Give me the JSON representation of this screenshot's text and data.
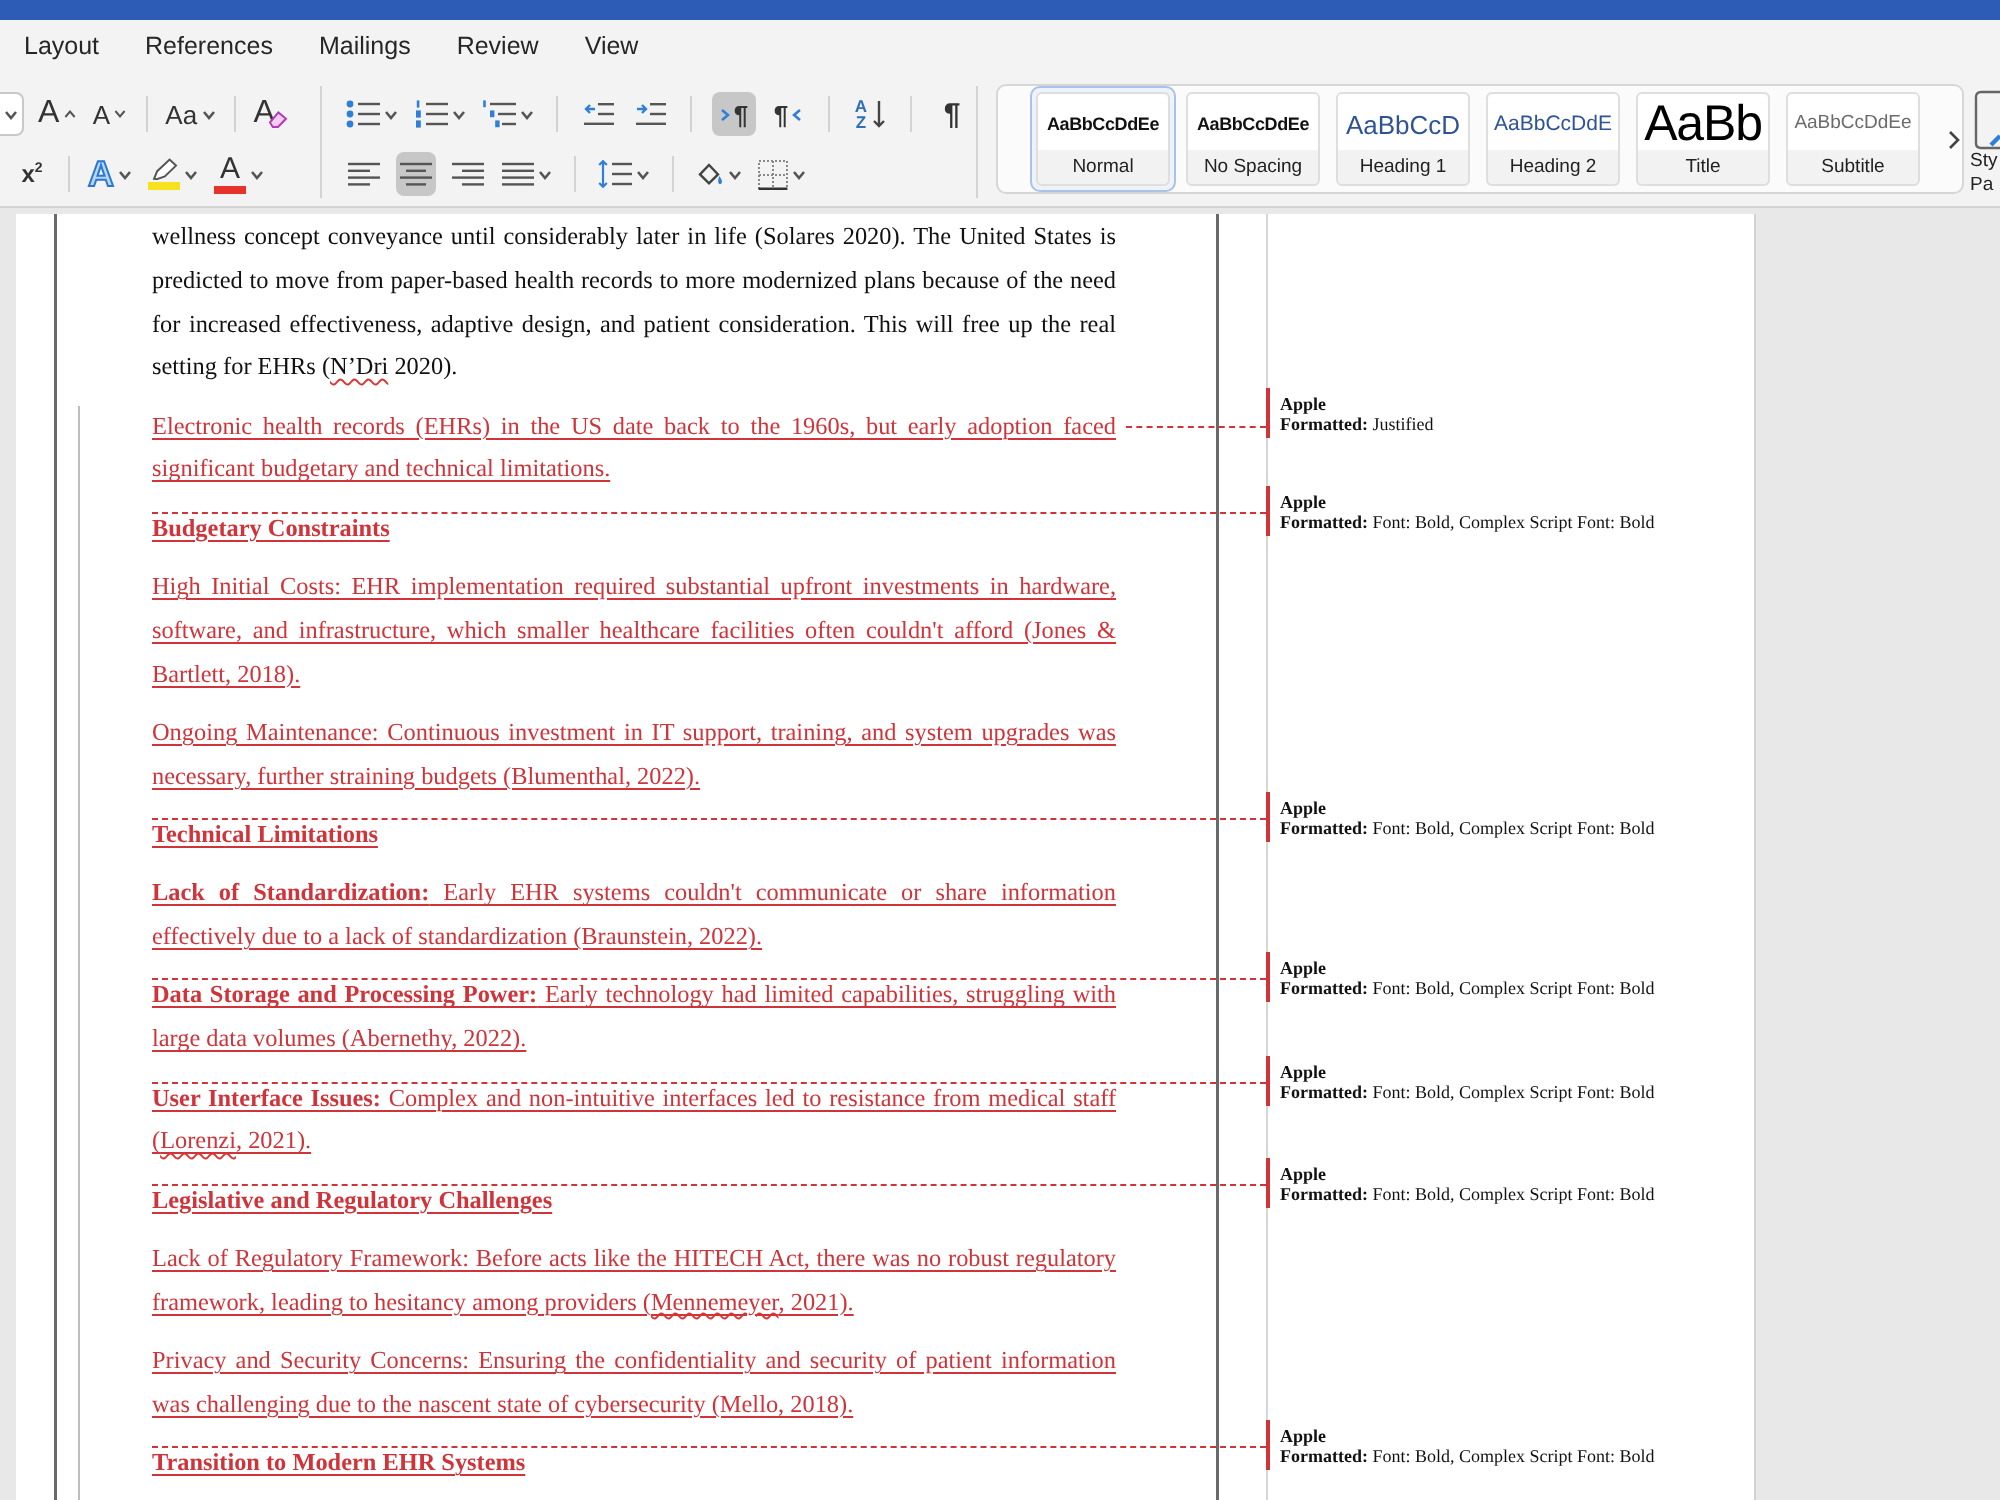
{
  "ribbon": {
    "tabs": [
      {
        "label": "Layout"
      },
      {
        "label": "References"
      },
      {
        "label": "Mailings"
      },
      {
        "label": "Review"
      },
      {
        "label": "View"
      }
    ],
    "font_group": {
      "rows": [
        [
          [
            {
              "kind": "font_size",
              "dropdown": true
            },
            {
              "kind": "grow_font",
              "label": "A",
              "dropdown": false
            },
            {
              "kind": "shrink_font",
              "label": "A",
              "dropdown": false
            }
          ],
          [
            {
              "kind": "change_case",
              "label": "Aa",
              "dropdown": true
            }
          ],
          [
            {
              "kind": "clear_formatting",
              "label": "A",
              "dropdown": false
            }
          ]
        ],
        [
          [
            {
              "kind": "superscript",
              "label": "x$^{2}$",
              "dropdown": false
            }
          ],
          [
            {
              "kind": "text_effects",
              "label": "A",
              "dropdown": true
            },
            {
              "kind": "highlight",
              "color": "#f5e21c",
              "dropdown": true
            },
            {
              "kind": "font_color",
              "label": "A",
              "color": "#e5322d",
              "dropdown": true
            }
          ]
        ]
      ]
    },
    "paragraph_group": {
      "rows": [
        [
          [
            {
              "kind": "bullets",
              "dropdown": true
            },
            {
              "kind": "numbering",
              "dropdown": true
            },
            {
              "kind": "multilevel",
              "dropdown": true
            }
          ],
          [
            {
              "kind": "decrease_indent",
              "dropdown": false
            },
            {
              "kind": "increase_indent",
              "dropdown": false
            }
          ],
          [
            {
              "kind": "ltr",
              "label": "¶",
              "selected": true,
              "dropdown": false
            },
            {
              "kind": "rtl",
              "label": "¶",
              "selected": false,
              "dropdown": false
            }
          ],
          [
            {
              "kind": "sort",
              "label": "A Z",
              "dropdown": false
            }
          ],
          [
            {
              "kind": "show_marks",
              "label": "¶",
              "dropdown": false
            }
          ]
        ],
        [
          [
            {
              "kind": "align_left",
              "selected": false,
              "dropdown": false
            },
            {
              "kind": "align_center",
              "selected": true,
              "dropdown": false
            },
            {
              "kind": "align_right",
              "selected": false,
              "dropdown": false
            },
            {
              "kind": "justify",
              "selected": false,
              "dropdown": true
            }
          ],
          [
            {
              "kind": "line_spacing",
              "dropdown": true
            }
          ],
          [
            {
              "kind": "shading",
              "dropdown": true
            },
            {
              "kind": "borders",
              "dropdown": true
            }
          ]
        ]
      ]
    },
    "styles": {
      "items": [
        {
          "kind": "normal",
          "preview": "AaBbCcDdEe",
          "name": "Normal",
          "selected": true
        },
        {
          "kind": "no_spacing",
          "preview": "AaBbCcDdEe",
          "name": "No Spacing",
          "selected": false
        },
        {
          "kind": "heading_1",
          "preview": "AaBbCcD",
          "name": "Heading 1",
          "selected": false
        },
        {
          "kind": "heading_2",
          "preview": "AaBbCcDdE",
          "name": "Heading 2",
          "selected": false
        },
        {
          "kind": "title",
          "preview": "AaBb",
          "name": "Title",
          "selected": false
        },
        {
          "kind": "subtitle",
          "preview": "AaBbCcDdEe",
          "name": "Subtitle",
          "selected": false
        }
      ],
      "pane_label": "Sty Pa"
    }
  },
  "document": {
    "paragraphs": [
      {
        "kind": "body",
        "inserted": false,
        "runs": [
          {
            "text": "wellness concept conveyance until considerably later in life (Solares 2020). The United States is predicted to move from paper-based health records to more modernized plans because of the need for increased effectiveness, adaptive design, and patient consideration. This will free up the real setting for EHRs (",
            "misspelled": false
          },
          {
            "text": "N’Dri",
            "misspelled": true
          },
          {
            "text": " 2020).",
            "misspelled": false
          }
        ]
      },
      {
        "kind": "body",
        "inserted": true,
        "text": "Electronic health records (EHRs) in the US date back to the 1960s, but early adoption faced significant budgetary and technical limitations.",
        "balloon": {
          "kind": "paragraph",
          "author": "Apple",
          "text": "**Formatted:** Justified"
        }
      },
      {
        "kind": "heading",
        "inserted": true,
        "text": "Budgetary Constraints",
        "balloon": {
          "kind": "character",
          "author": "Apple",
          "text": "**Formatted:** Font: Bold, Complex Script Font: Bold"
        }
      },
      {
        "kind": "body",
        "inserted": true,
        "text": "High Initial Costs: EHR implementation required substantial upfront investments in hardware, software, and infrastructure, which smaller healthcare facilities often couldn't afford (Jones & Bartlett, 2018)."
      },
      {
        "kind": "body",
        "inserted": true,
        "text": "Ongoing Maintenance: Continuous investment in IT support, training, and system upgrades was necessary, further straining budgets (Blumenthal, 2022)."
      },
      {
        "kind": "heading",
        "inserted": true,
        "text": "Technical Limitations",
        "balloon": {
          "kind": "character",
          "author": "Apple",
          "text": "**Formatted:** Font: Bold, Complex Script Font: Bold"
        }
      },
      {
        "kind": "body",
        "inserted": true,
        "text": "**Lack of Standardization:** Early EHR systems couldn't communicate or share information effectively due to a lack of standardization (Braunstein, 2022)."
      },
      {
        "kind": "body",
        "inserted": true,
        "text": "**Data Storage and Processing Power:** Early technology had limited capabilities, struggling with large data volumes (Abernethy, 2022).",
        "balloon": {
          "kind": "character",
          "author": "Apple",
          "text": "**Formatted:** Font: Bold, Complex Script Font: Bold"
        }
      },
      {
        "kind": "body",
        "inserted": true,
        "runs": [
          {
            "text": "**User Interface Issues:** Complex and non-intuitive interfaces led to resistance from medical staff (",
            "misspelled": false
          },
          {
            "text": "Lorenzi",
            "misspelled": true
          },
          {
            "text": ", 2021).",
            "misspelled": false
          }
        ],
        "balloon": {
          "kind": "character",
          "author": "Apple",
          "text": "**Formatted:** Font: Bold, Complex Script Font: Bold"
        }
      },
      {
        "kind": "heading",
        "inserted": true,
        "text": "Legislative and Regulatory Challenges",
        "balloon": {
          "kind": "character",
          "author": "Apple",
          "text": "**Formatted:** Font: Bold, Complex Script Font: Bold"
        }
      },
      {
        "kind": "body",
        "inserted": true,
        "runs": [
          {
            "text": "Lack of Regulatory Framework: Before acts like the HITECH Act, there was no robust regulatory framework, leading to hesitancy among providers (",
            "misspelled": false
          },
          {
            "text": "Mennemeyer",
            "misspelled": true
          },
          {
            "text": ", 2021).",
            "misspelled": false
          }
        ]
      },
      {
        "kind": "body",
        "inserted": true,
        "text": "Privacy and Security Concerns: Ensuring the confidentiality and security of patient information was challenging due to the nascent state of cybersecurity (Mello, 2018)."
      },
      {
        "kind": "heading",
        "inserted": true,
        "text": "Transition to Modern EHR Systems",
        "balloon": {
          "kind": "character",
          "author": "Apple",
          "text": "**Formatted:** Font: Bold, Complex Script Font: Bold"
        }
      }
    ]
  }
}
